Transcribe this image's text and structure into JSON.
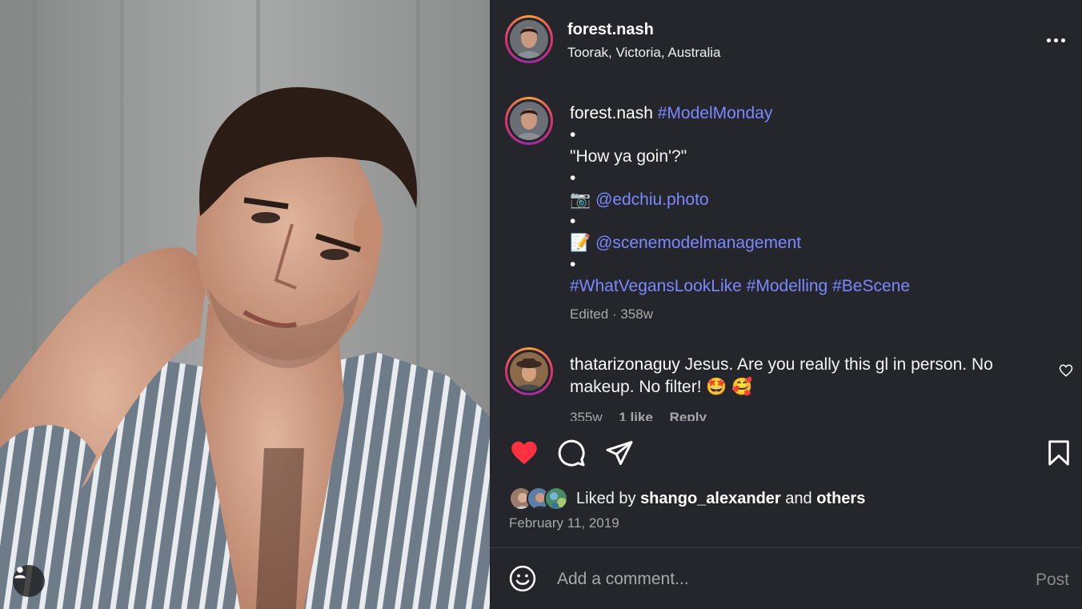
{
  "post": {
    "username": "forest.nash",
    "location": "Toorak, Victoria, Australia"
  },
  "caption": {
    "username": "forest.nash",
    "tag_model_monday": "#ModelMonday",
    "bullet": "•",
    "quote": "\"How ya goin'?\"",
    "camera_emoji": "📷",
    "photographer": "@edchiu.photo",
    "memo_emoji": "📝",
    "agency": "@scenemodelmanagement",
    "tag_vegans": "#WhatVegansLookLike",
    "tag_modelling": "#Modelling",
    "tag_bescene": "#BeScene",
    "edited": "Edited",
    "separator": "·",
    "age": "358w"
  },
  "comment": {
    "username": "thatarizonaguy",
    "text": "Jesus. Are you really this gl in person. No makeup. No filter!",
    "emojis": "🤩 🥰",
    "age": "355w",
    "likes": "1 like",
    "reply": "Reply"
  },
  "likes": {
    "liked_by": "Liked by",
    "user": "shango_alexander",
    "and": "and",
    "others": "others"
  },
  "date": "February 11, 2019",
  "composer": {
    "placeholder": "Add a comment...",
    "post_label": "Post"
  },
  "icons": {
    "like": "heart-filled-icon",
    "comment": "comment-bubble-icon",
    "share": "paper-plane-icon",
    "save": "bookmark-icon",
    "more": "more-horizontal-icon",
    "emoji": "smiley-icon",
    "tag": "user-tag-icon"
  },
  "colors": {
    "panel_bg": "#25262b",
    "link": "#7a89ff",
    "like_red": "#ff3040",
    "muted": "#a8a8a8"
  }
}
